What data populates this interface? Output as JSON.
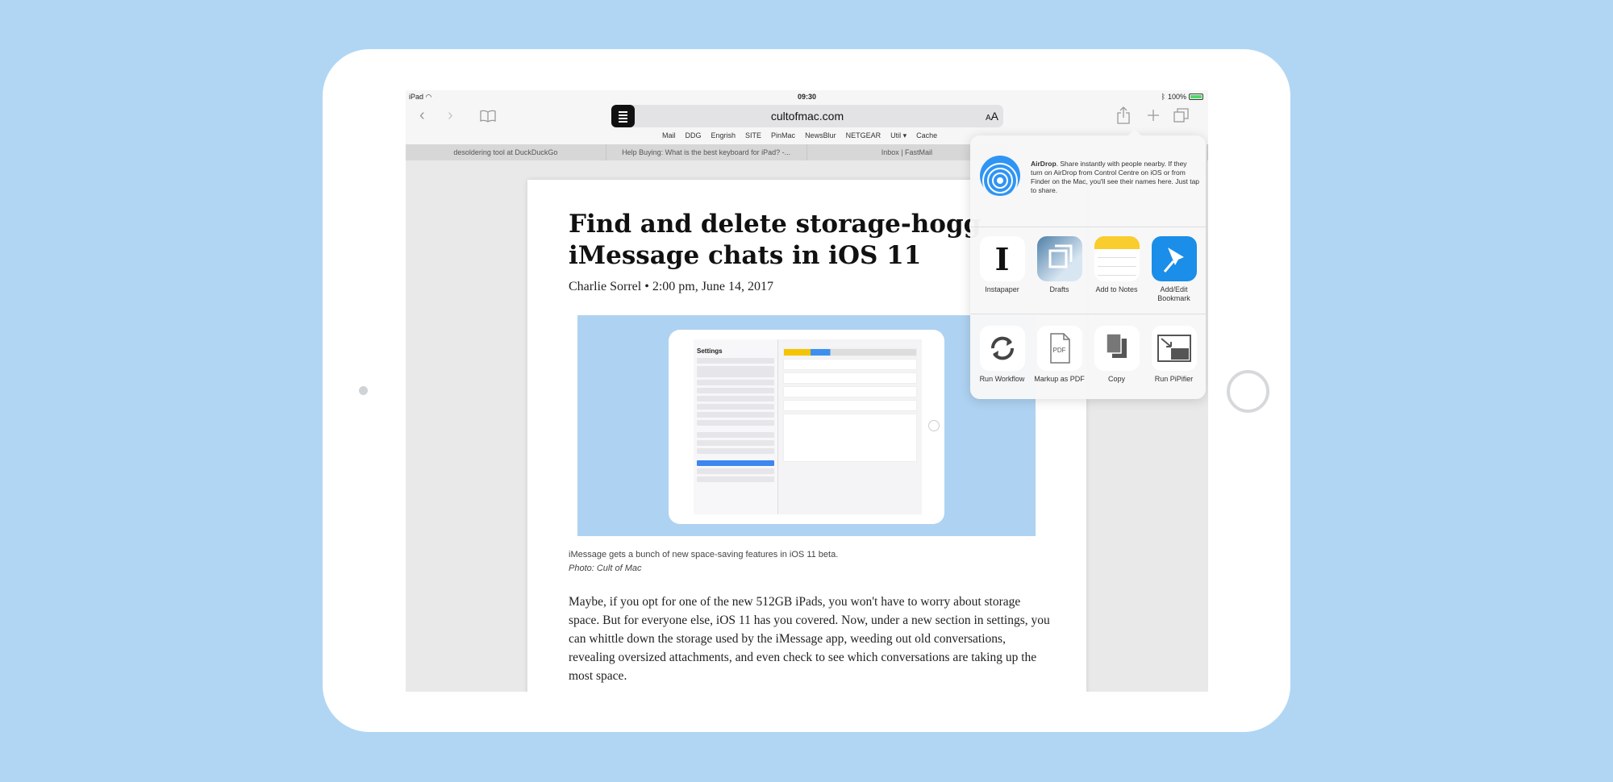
{
  "status": {
    "device": "iPad",
    "time": "09:30",
    "battery": "100%"
  },
  "toolbar": {
    "url": "cultofmac.com",
    "text_size_small": "A",
    "text_size_large": "A"
  },
  "favorites": [
    "Mail",
    "DDG",
    "Engrish",
    "SITE",
    "PinMac",
    "NewsBlur",
    "NETGEAR",
    "Util ▾",
    "Cache"
  ],
  "tabs": [
    "desoldering tool at DuckDuckGo",
    "Help Buying: What is the best keyboard for iPad? -...",
    "Inbox | FastMail"
  ],
  "article": {
    "title": "Find and delete storage-hogg iMessage chats in iOS 11",
    "author": "Charlie Sorrel",
    "separator": "•",
    "date": "2:00 pm, June 14, 2017",
    "caption": "iMessage gets a bunch of new space-saving features in iOS 11 beta.",
    "credit": "Photo: Cult of Mac",
    "body": "Maybe, if you opt for one of the new 512GB iPads, you won't have to worry about storage space. But for everyone else, iOS 11 has you covered. Now, under a new section in settings, you can whittle down the storage used by the iMessage app, weeding out old conversations, revealing oversized attachments, and even check to see which conversations are taking up the most space."
  },
  "hero_mini": {
    "settings_title": "Settings"
  },
  "share": {
    "airdrop_title": "AirDrop",
    "airdrop_text": ". Share instantly with people nearby. If they turn on AirDrop from Control Centre on iOS or from Finder on the Mac, you'll see their names here. Just tap to share.",
    "row1": [
      {
        "label": "Instapaper",
        "icon": "instapaper-icon"
      },
      {
        "label": "Drafts",
        "icon": "drafts-icon"
      },
      {
        "label": "Add to Notes",
        "icon": "notes-icon"
      },
      {
        "label": "Add/Edit Bookmark",
        "icon": "pushpin-icon"
      }
    ],
    "row2": [
      {
        "label": "Run Workflow",
        "icon": "workflow-icon"
      },
      {
        "label": "Markup as PDF",
        "icon": "pdf-icon"
      },
      {
        "label": "Copy",
        "icon": "copy-icon"
      },
      {
        "label": "Run PiPifier",
        "icon": "pip-icon"
      }
    ],
    "pdf_glyph": "PDF",
    "instapaper_glyph": "I"
  },
  "colors": {
    "background": "#b0d6f4",
    "airdrop_blue": "#2f95f4",
    "bookmark_blue": "#1a8ee8",
    "notes_yellow": "#f9cd2e"
  }
}
